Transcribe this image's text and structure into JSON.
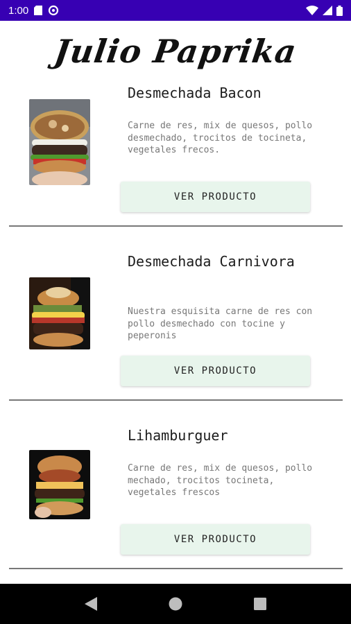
{
  "status_bar": {
    "time": "1:00",
    "bg_color": "#3700b3"
  },
  "brand": {
    "name": "Julio Paprika"
  },
  "products": [
    {
      "title": "Desmechada Bacon",
      "description": "Carne de res, mix de quesos, pollo desmechado, trocitos de tocineta, vegetales frecos.",
      "button_label": "VER PRODUCTO"
    },
    {
      "title": "Desmechada Carnivora",
      "description": "Nuestra esquisita carne de res con pollo desmechado con tocine y peperonis",
      "button_label": "VER PRODUCTO"
    },
    {
      "title": "Lihamburguer",
      "description": "Carne de res, mix de quesos, pollo mechado, trocitos tocineta, vegetales frescos",
      "button_label": "VER PRODUCTO"
    }
  ],
  "colors": {
    "button_bg": "#e8f5ec",
    "divider": "#777777",
    "nav_bar": "#000000"
  },
  "icons": {
    "status_left": [
      "sim-card-icon",
      "data-saver-icon"
    ],
    "status_right": [
      "wifi-icon",
      "signal-icon",
      "battery-icon"
    ],
    "nav": [
      "back-icon",
      "home-icon",
      "recents-icon"
    ]
  }
}
